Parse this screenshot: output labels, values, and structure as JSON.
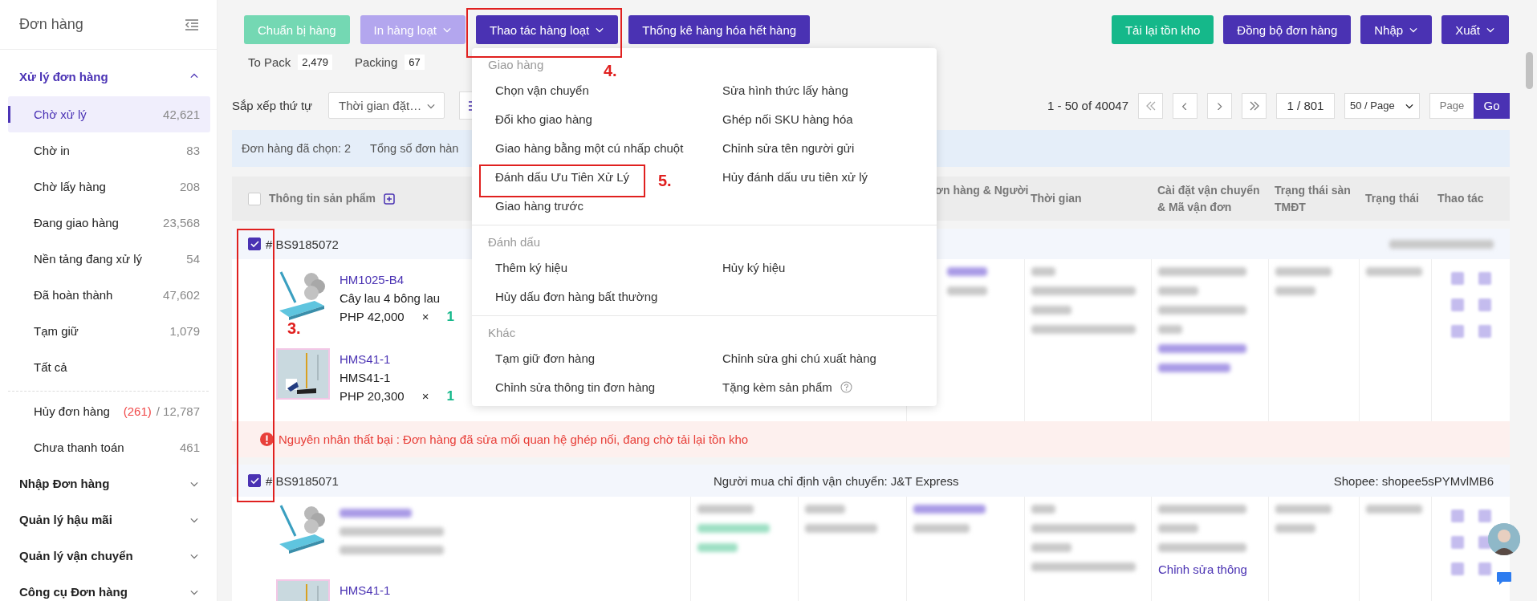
{
  "sidebar": {
    "title": "Đơn hàng",
    "sections": [
      {
        "label": "Xử lý đơn hàng",
        "expanded": true,
        "items": [
          {
            "label": "Chờ xử lý",
            "count": "42,621",
            "selected": true
          },
          {
            "label": "Chờ in",
            "count": "83",
            "selected": false
          },
          {
            "label": "Chờ lấy hàng",
            "count": "208",
            "selected": false
          },
          {
            "label": "Đang giao hàng",
            "count": "23,568",
            "selected": false
          },
          {
            "label": "Nền tảng đang xử lý",
            "count": "54",
            "selected": false
          },
          {
            "label": "Đã hoàn thành",
            "count": "47,602",
            "selected": false
          },
          {
            "label": "Tạm giữ",
            "count": "1,079",
            "selected": false
          },
          {
            "label": "Tất cả",
            "selected": false
          }
        ],
        "other_items": [
          {
            "label": "Hủy đơn hàng",
            "alert_count": "(261)",
            "count": "/ 12,787",
            "selected": false
          },
          {
            "label": "Chưa thanh toán",
            "count": "461",
            "selected": false
          }
        ]
      },
      {
        "label": "Nhập Đơn hàng",
        "expanded": false
      },
      {
        "label": "Quản lý hậu mãi",
        "expanded": false
      },
      {
        "label": "Quản lý vận chuyển",
        "expanded": false
      },
      {
        "label": "Công cụ Đơn hàng",
        "expanded": false
      }
    ]
  },
  "toolbar": {
    "left": [
      {
        "label": "Chuẩn bị hàng",
        "kind": "success",
        "disabled": true,
        "dropdown": false
      },
      {
        "label": "In hàng loạt",
        "kind": "primary",
        "disabled": true,
        "dropdown": true
      },
      {
        "label": "Thao tác hàng loạt",
        "kind": "primary",
        "disabled": false,
        "dropdown": true
      },
      {
        "label": "Thống kê hàng hóa hết hàng",
        "kind": "primary",
        "disabled": false,
        "dropdown": false
      }
    ],
    "right": [
      {
        "label": "Tải lại tồn kho",
        "kind": "success",
        "disabled": false,
        "dropdown": false
      },
      {
        "label": "Đồng bộ đơn hàng",
        "kind": "primary",
        "disabled": false,
        "dropdown": false
      },
      {
        "label": "Nhập",
        "kind": "primary",
        "disabled": false,
        "dropdown": true
      },
      {
        "label": "Xuất",
        "kind": "primary",
        "disabled": false,
        "dropdown": true
      }
    ]
  },
  "stats": [
    {
      "label": "To Pack",
      "count": "2,479"
    },
    {
      "label": "Packing",
      "count": "67"
    }
  ],
  "sort": {
    "label": "Sắp xếp thứ tự",
    "value": "Thời gian đặt…"
  },
  "pagination": {
    "range": "1 - 50 of 40047",
    "page": "1 / 801",
    "page_size": "50 / Page",
    "jump_placeholder": "Page",
    "go": "Go"
  },
  "selection_bar": [
    "Đơn hàng đã chọn: 2",
    "Tổng số đơn hàn"
  ],
  "table": {
    "select_all": {
      "checked": false
    },
    "columns": [
      {
        "label": "Thông tin sản phẩm",
        "add": true
      },
      {
        "label": "ơn hàng & Người"
      },
      {
        "label": "Thời gian"
      },
      {
        "label": "Cài đặt vận chuyển & Mã vận đơn"
      },
      {
        "label": "Trạng thái sàn TMĐT"
      },
      {
        "label": "Trạng thái"
      },
      {
        "label": "Thao tác"
      }
    ]
  },
  "orders": [
    {
      "number": "# BS9185072",
      "selected": true,
      "products": [
        {
          "sku": "HM1025-B4",
          "name": "Cây lau 4 bông lau",
          "price": "PHP 42,000",
          "times": "×",
          "quantity": "1"
        },
        {
          "sku": "HMS41-1",
          "name": "HMS41-1",
          "price": "PHP 20,300",
          "times": "×",
          "quantity": "1"
        }
      ],
      "error": "Nguyên nhân thất bại : Đơn hàng đã sửa mối quan hệ ghép nối, đang chờ tải lại tồn kho"
    },
    {
      "number": "# BS9185071",
      "selected": true,
      "shipping_note": "Người mua chỉ định vận chuyển: J&T Express",
      "store": "Shopee: shopee5sPYMvlMB6",
      "products": [
        {
          "blurred": true
        },
        {
          "sku": "HMS41-1",
          "blurred": false
        }
      ],
      "shipping_link": "Chỉnh sửa thông"
    }
  ],
  "menu": {
    "groups": [
      {
        "title": "Giao hàng",
        "items": [
          {
            "label": "Chọn vận chuyển"
          },
          {
            "label": "Sửa hình thức lấy hàng"
          },
          {
            "label": "Đổi kho giao hàng"
          },
          {
            "label": "Ghép nối SKU hàng hóa"
          },
          {
            "label": "Giao hàng bằng một cú nhấp chuột"
          },
          {
            "label": "Chỉnh sửa tên người gửi"
          },
          {
            "label": "Đánh dấu Ưu Tiên Xử Lý"
          },
          {
            "label": "Hủy đánh dấu ưu tiên xử lý"
          },
          {
            "label": "Giao hàng trước"
          }
        ]
      },
      {
        "title": "Đánh dấu",
        "items": [
          {
            "label": "Thêm ký hiệu"
          },
          {
            "label": "Hủy ký hiệu"
          },
          {
            "label": "Hủy dấu đơn hàng bất thường"
          }
        ]
      },
      {
        "title": "Khác",
        "items": [
          {
            "label": "Tạm giữ đơn hàng"
          },
          {
            "label": "Chỉnh sửa ghi chú xuất hàng"
          },
          {
            "label": "Chỉnh sửa thông tin đơn hàng"
          },
          {
            "label": "Tặng kèm sản phẩm",
            "help": true
          }
        ]
      }
    ]
  },
  "annotations": [
    {
      "kind": "checkbox-column",
      "label": "3."
    },
    {
      "kind": "bulk-action-button",
      "label": "4."
    },
    {
      "kind": "menu-item",
      "label": "5."
    }
  ]
}
